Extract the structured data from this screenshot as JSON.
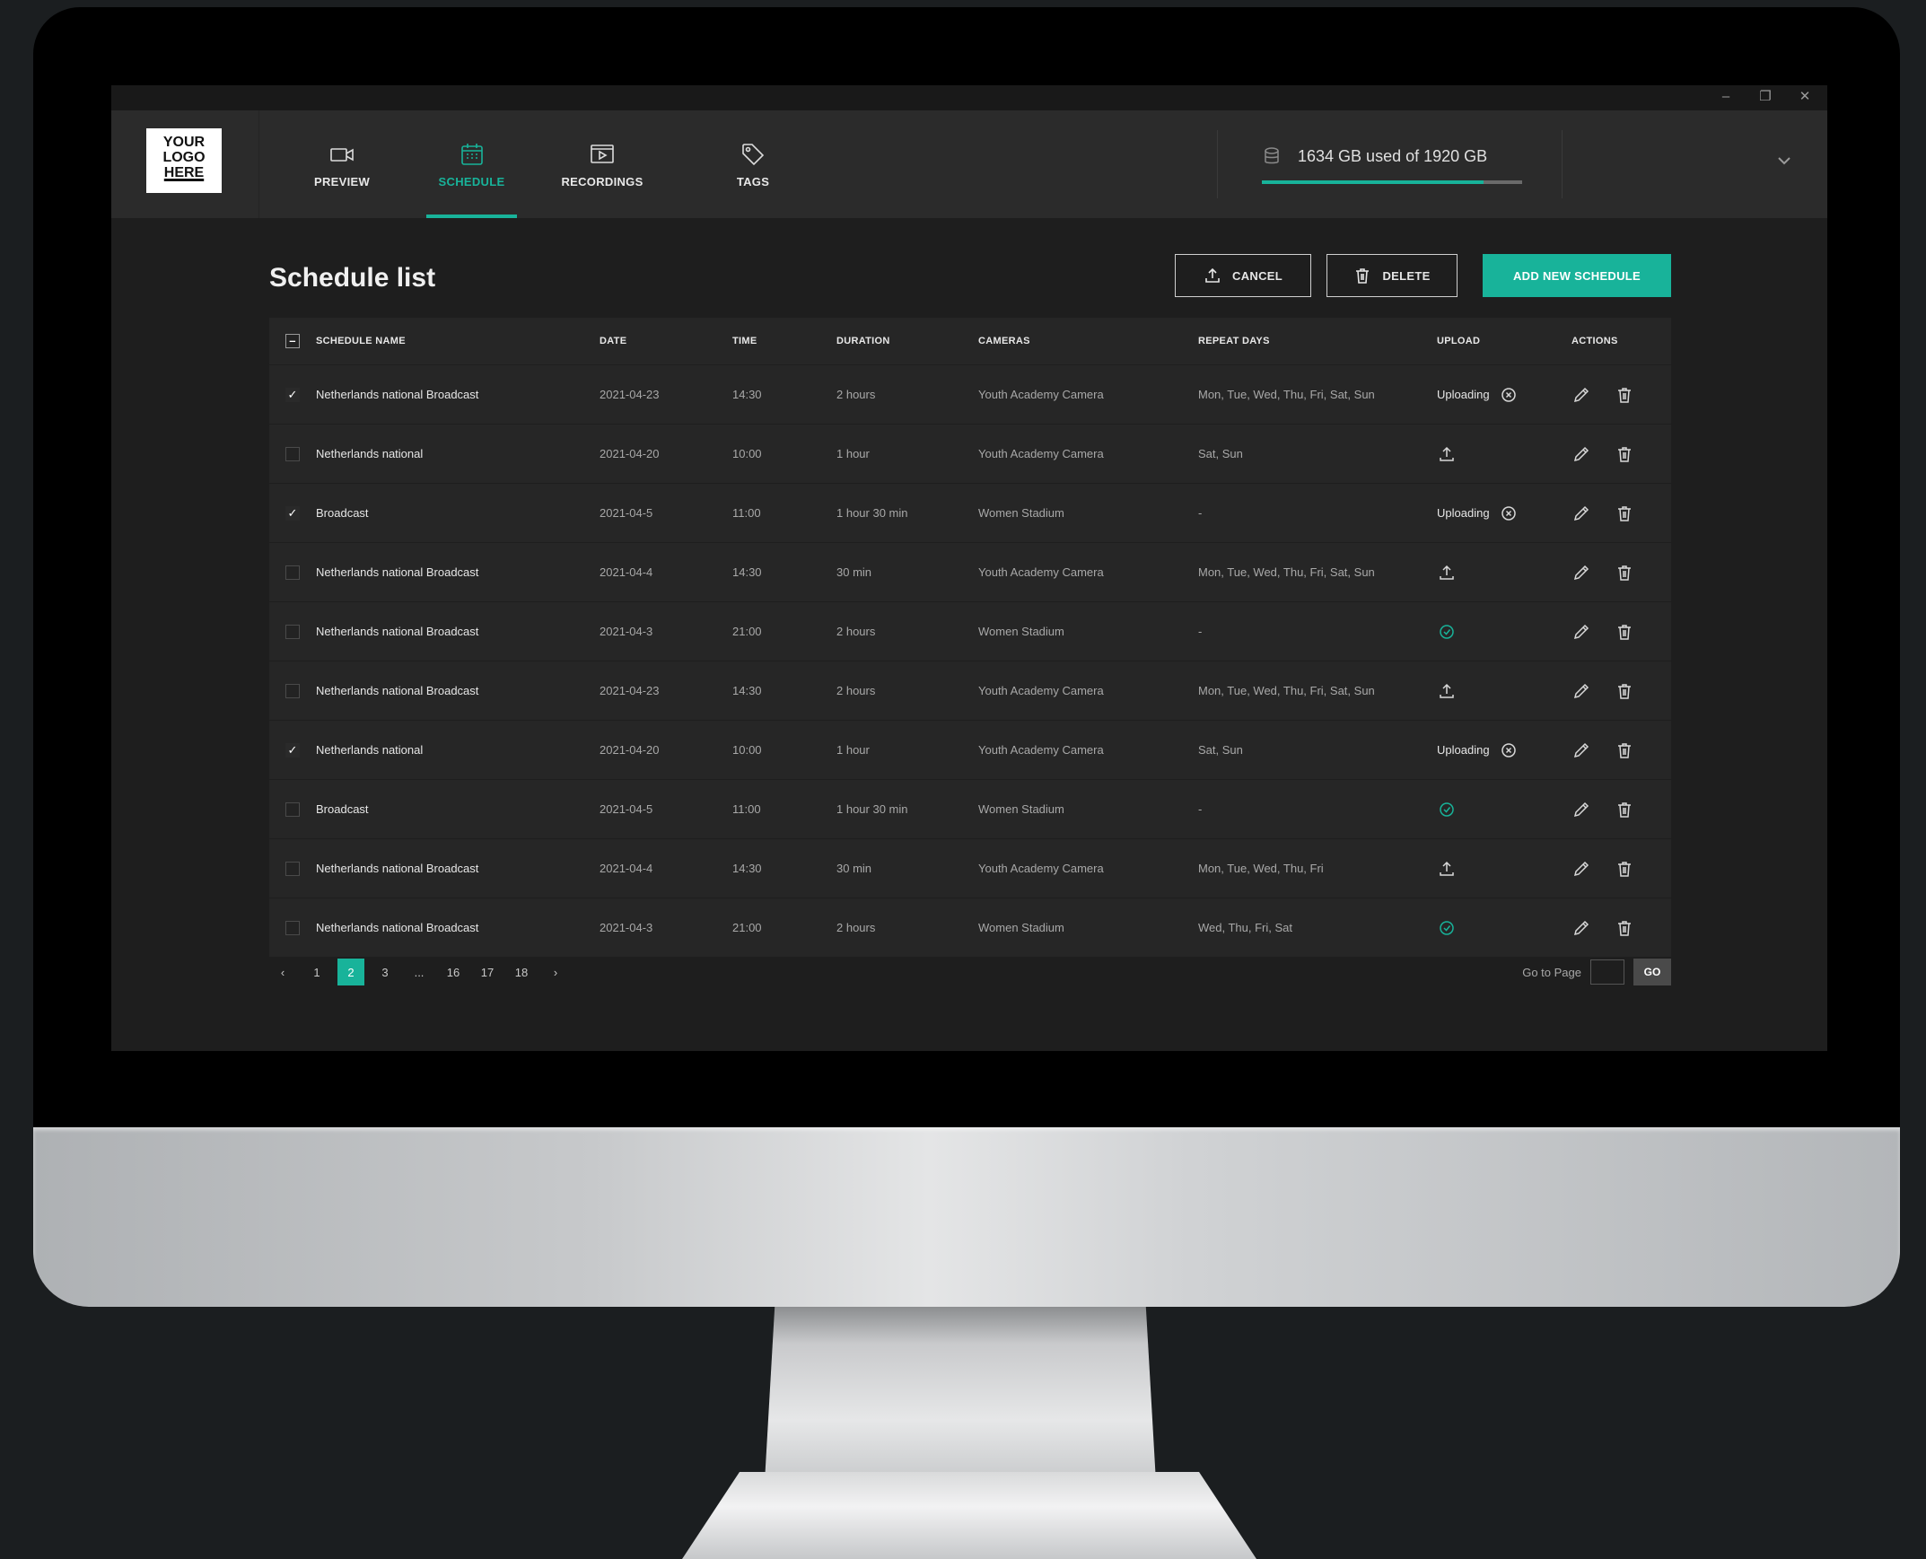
{
  "window": {
    "controls": [
      "–",
      "❐",
      "✕"
    ]
  },
  "logo": {
    "lines": [
      "YOUR",
      "LOGO",
      "HERE"
    ]
  },
  "nav": [
    {
      "label": "PREVIEW",
      "icon": "video-camera-icon"
    },
    {
      "label": "SCHEDULE",
      "icon": "calendar-icon",
      "active": true
    },
    {
      "label": "RECORDINGS",
      "icon": "play-screen-icon"
    },
    {
      "label": "TAGS",
      "icon": "tag-icon"
    }
  ],
  "storage": {
    "text": "1634 GB used of 1920 GB",
    "used_gb": 1634,
    "total_gb": 1920,
    "icon": "database-icon"
  },
  "page": {
    "title": "Schedule list"
  },
  "actions": {
    "cancel": "CANCEL",
    "delete": "DELETE",
    "add": "ADD NEW SCHEDULE"
  },
  "accent": "#18b39a",
  "table": {
    "headers": [
      "SCHEDULE NAME",
      "DATE",
      "TIME",
      "DURATION",
      "CAMERAS",
      "REPEAT DAYS",
      "UPLOAD",
      "ACTIONS"
    ],
    "rows": [
      {
        "checked": true,
        "name": "Netherlands national Broadcast",
        "date": "2021-04-23",
        "time": "14:30",
        "duration": "2 hours",
        "camera": "Youth Academy Camera",
        "repeat": "Mon, Tue, Wed, Thu, Fri, Sat, Sun",
        "upload": "uploading",
        "upload_text": "Uploading"
      },
      {
        "checked": false,
        "name": "Netherlands national",
        "date": "2021-04-20",
        "time": "10:00",
        "duration": "1 hour",
        "camera": "Youth Academy Camera",
        "repeat": "Sat, Sun",
        "upload": "pending",
        "upload_text": ""
      },
      {
        "checked": true,
        "name": "Broadcast",
        "date": "2021-04-5",
        "time": "11:00",
        "duration": "1 hour  30 min",
        "camera": "Women Stadium",
        "repeat": "-",
        "upload": "uploading",
        "upload_text": "Uploading"
      },
      {
        "checked": false,
        "name": "Netherlands national Broadcast",
        "date": "2021-04-4",
        "time": "14:30",
        "duration": "30 min",
        "camera": "Youth Academy Camera",
        "repeat": "Mon, Tue, Wed, Thu, Fri, Sat, Sun",
        "upload": "pending",
        "upload_text": ""
      },
      {
        "checked": false,
        "name": "Netherlands national Broadcast",
        "date": "2021-04-3",
        "time": "21:00",
        "duration": "2 hours",
        "camera": "Women Stadium",
        "repeat": "-",
        "upload": "done",
        "upload_text": ""
      },
      {
        "checked": false,
        "name": "Netherlands national Broadcast",
        "date": "2021-04-23",
        "time": "14:30",
        "duration": "2 hours",
        "camera": "Youth Academy Camera",
        "repeat": "Mon, Tue, Wed, Thu, Fri, Sat, Sun",
        "upload": "pending",
        "upload_text": ""
      },
      {
        "checked": true,
        "name": "Netherlands national",
        "date": "2021-04-20",
        "time": "10:00",
        "duration": "1 hour",
        "camera": "Youth Academy Camera",
        "repeat": "Sat, Sun",
        "upload": "uploading",
        "upload_text": "Uploading"
      },
      {
        "checked": false,
        "name": "Broadcast",
        "date": "2021-04-5",
        "time": "11:00",
        "duration": "1 hour  30 min",
        "camera": "Women Stadium",
        "repeat": "-",
        "upload": "done",
        "upload_text": ""
      },
      {
        "checked": false,
        "name": "Netherlands national Broadcast",
        "date": "2021-04-4",
        "time": "14:30",
        "duration": "30 min",
        "camera": "Youth Academy Camera",
        "repeat": "Mon, Tue, Wed, Thu, Fri",
        "upload": "pending",
        "upload_text": ""
      },
      {
        "checked": false,
        "name": "Netherlands national Broadcast",
        "date": "2021-04-3",
        "time": "21:00",
        "duration": "2 hours",
        "camera": "Women Stadium",
        "repeat": "Wed, Thu, Fri, Sat",
        "upload": "done",
        "upload_text": ""
      }
    ]
  },
  "pagination": {
    "prev": "‹",
    "next": "›",
    "pages": [
      "1",
      "2",
      "3",
      "...",
      "16",
      "17",
      "18"
    ],
    "current": "2"
  },
  "goto": {
    "label": "Go to Page",
    "value": "",
    "button": "GO"
  }
}
